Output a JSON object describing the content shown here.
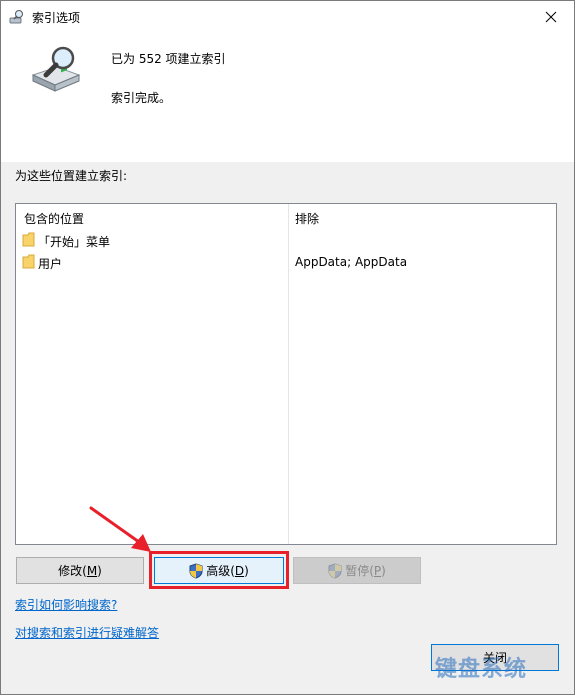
{
  "window": {
    "title": "索引选项"
  },
  "status": {
    "count_text": "已为 552 项建立索引",
    "done_text": "索引完成。"
  },
  "locations": {
    "section_label": "为这些位置建立索引:",
    "col_included": "包含的位置",
    "col_excluded": "排除",
    "rows": [
      {
        "name": "「开始」菜单",
        "excluded": ""
      },
      {
        "name": "用户",
        "excluded": "AppData; AppData"
      }
    ]
  },
  "buttons": {
    "modify_label": "修改(",
    "modify_key": "M",
    "advanced_label": "高级(",
    "advanced_key": "D",
    "pause_label": "暂停(",
    "pause_key": "P",
    "close_label": "关闭"
  },
  "links": {
    "how_index": "索引如何影响搜索?",
    "troubleshoot": "对搜索和索引进行疑难解答"
  },
  "watermark": "键盘系统",
  "colors": {
    "link": "#0066cc",
    "highlight": "#e8202a",
    "accent": "#0078d7"
  }
}
